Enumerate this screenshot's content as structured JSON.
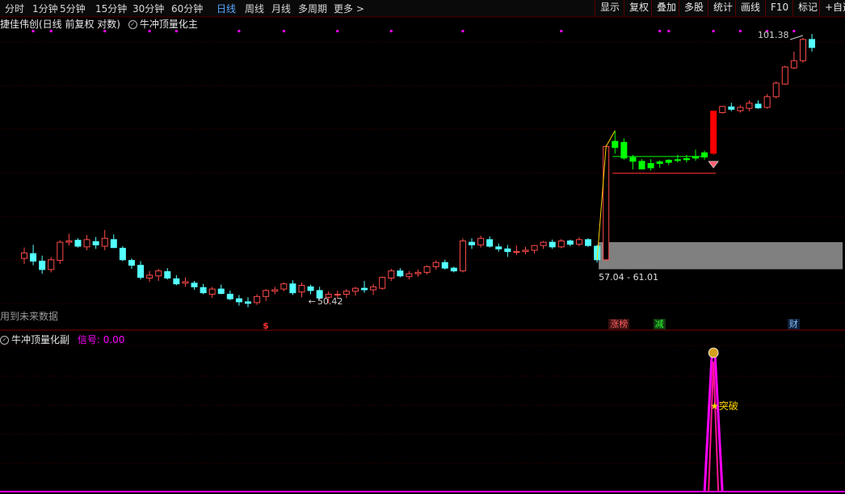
{
  "toolbar": {
    "periods": [
      {
        "label": "分时",
        "active": false
      },
      {
        "label": "1分钟",
        "active": false
      },
      {
        "label": "5分钟",
        "active": false
      },
      {
        "label": "15分钟",
        "active": false
      },
      {
        "label": "30分钟",
        "active": false
      },
      {
        "label": "60分钟",
        "active": false
      },
      {
        "label": "日线",
        "active": true
      },
      {
        "label": "周线",
        "active": false
      },
      {
        "label": "月线",
        "active": false
      },
      {
        "label": "多周期",
        "active": false
      },
      {
        "label": "更多 >",
        "active": false
      }
    ],
    "buttons": [
      "显示",
      "复权",
      "叠加",
      "多股",
      "统计",
      "画线",
      "F10",
      "标记",
      "+自选"
    ]
  },
  "main_panel": {
    "stock_title": "捷佳伟创(日线 前复权 对数)",
    "indicator_name": "牛冲顶量化主",
    "future_data_note": "用到未来数据",
    "high_label": "101.38",
    "low_label": "50.42",
    "zone_label": "57.04 - 61.01",
    "markers": {
      "dollar": "$",
      "zhangbang": "涨榜",
      "jian": "减",
      "cai": "财"
    }
  },
  "sub_panel": {
    "indicator_name": "牛冲顶量化副",
    "signal_label": "信号:",
    "signal_value": "0.00",
    "breakout_label": "突破"
  },
  "colors": {
    "up": "#ff4a4a",
    "down": "#54ffff",
    "signal_green": "#00ff00",
    "magenta": "#ff00ff",
    "pink_line": "#ff1493",
    "zone_gray": "#808080",
    "gold": "#ffd700"
  },
  "chart_data": {
    "type": "candlestick",
    "scale": "log",
    "candles": [
      [
        58.6,
        60.2,
        57.8,
        59.4
      ],
      [
        59.3,
        60.6,
        57.6,
        58.2
      ],
      [
        58.2,
        59.0,
        56.4,
        57.0
      ],
      [
        57.0,
        58.8,
        56.6,
        58.4
      ],
      [
        58.3,
        61.3,
        57.8,
        61.0
      ],
      [
        61.0,
        62.3,
        60.5,
        61.2
      ],
      [
        61.3,
        61.6,
        60.2,
        60.4
      ],
      [
        60.3,
        62.1,
        59.8,
        61.4
      ],
      [
        61.1,
        61.8,
        60.0,
        60.6
      ],
      [
        60.4,
        62.9,
        59.8,
        61.6
      ],
      [
        61.4,
        62.2,
        60.1,
        60.2
      ],
      [
        60.1,
        60.4,
        58.2,
        58.4
      ],
      [
        58.3,
        58.6,
        57.1,
        57.6
      ],
      [
        57.6,
        58.2,
        55.6,
        55.9
      ],
      [
        55.8,
        56.8,
        55.3,
        56.2
      ],
      [
        56.1,
        57.1,
        55.4,
        56.8
      ],
      [
        56.7,
        57.2,
        55.6,
        55.8
      ],
      [
        55.7,
        56.2,
        54.8,
        55.0
      ],
      [
        55.1,
        55.9,
        54.6,
        55.3
      ],
      [
        55.1,
        55.4,
        54.2,
        54.6
      ],
      [
        54.5,
        55.0,
        53.6,
        53.8
      ],
      [
        53.6,
        54.6,
        53.1,
        54.3
      ],
      [
        54.3,
        54.9,
        53.6,
        53.7
      ],
      [
        53.6,
        54.1,
        52.8,
        53.0
      ],
      [
        53.0,
        53.5,
        52.1,
        52.6
      ],
      [
        52.6,
        53.2,
        51.9,
        52.4
      ],
      [
        52.5,
        53.6,
        52.2,
        53.3
      ],
      [
        53.3,
        54.3,
        52.7,
        54.1
      ],
      [
        54.0,
        54.6,
        53.6,
        54.2
      ],
      [
        54.3,
        55.2,
        54.0,
        55.0
      ],
      [
        55.0,
        55.5,
        53.5,
        53.8
      ],
      [
        53.9,
        55.2,
        53.2,
        54.8
      ],
      [
        54.6,
        54.9,
        53.6,
        54.1
      ],
      [
        54.1,
        54.6,
        52.9,
        53.1
      ],
      [
        53.2,
        54.0,
        52.4,
        53.6
      ],
      [
        53.5,
        54.1,
        53.0,
        53.6
      ],
      [
        53.6,
        54.3,
        53.1,
        54.0
      ],
      [
        54.0,
        54.6,
        53.4,
        54.4
      ],
      [
        54.4,
        55.4,
        53.8,
        54.2
      ],
      [
        54.2,
        55.0,
        53.5,
        54.6
      ],
      [
        54.4,
        56.0,
        54.2,
        55.9
      ],
      [
        55.8,
        57.1,
        55.4,
        56.8
      ],
      [
        56.8,
        57.2,
        55.9,
        56.1
      ],
      [
        56.0,
        56.8,
        55.6,
        56.4
      ],
      [
        56.4,
        57.0,
        56.0,
        56.6
      ],
      [
        56.6,
        57.6,
        56.3,
        57.4
      ],
      [
        57.4,
        58.3,
        57.0,
        58.0
      ],
      [
        58.0,
        58.4,
        57.0,
        57.2
      ],
      [
        57.2,
        57.4,
        56.6,
        56.8
      ],
      [
        56.8,
        61.6,
        56.6,
        61.2
      ],
      [
        61.0,
        61.6,
        60.0,
        60.6
      ],
      [
        60.6,
        62.0,
        60.2,
        61.6
      ],
      [
        61.4,
        61.9,
        60.2,
        60.4
      ],
      [
        60.3,
        60.8,
        59.6,
        60.0
      ],
      [
        60.0,
        60.6,
        58.8,
        59.6
      ],
      [
        59.6,
        60.5,
        59.1,
        59.6
      ],
      [
        59.6,
        60.3,
        59.2,
        59.8
      ],
      [
        59.8,
        60.6,
        59.3,
        60.5
      ],
      [
        60.5,
        61.2,
        60.0,
        61.0
      ],
      [
        61.0,
        61.4,
        60.0,
        60.3
      ],
      [
        60.3,
        61.5,
        60.1,
        61.2
      ],
      [
        61.2,
        61.4,
        60.4,
        60.7
      ],
      [
        60.7,
        61.8,
        60.4,
        61.4
      ],
      [
        61.4,
        61.6,
        60.3,
        60.5
      ],
      [
        60.4,
        60.6,
        58.0,
        58.4
      ],
      [
        58.4,
        77.6,
        58.2,
        77.4
      ],
      [
        77.2,
        80.5,
        76.0,
        78.4
      ],
      [
        78.2,
        79.0,
        74.9,
        75.2
      ],
      [
        75.3,
        75.8,
        73.1,
        74.6
      ],
      [
        74.6,
        75.0,
        73.1,
        73.2
      ],
      [
        73.4,
        75.0,
        72.9,
        74.2
      ],
      [
        74.2,
        74.8,
        73.4,
        74.5
      ],
      [
        74.4,
        75.0,
        73.9,
        74.8
      ],
      [
        74.8,
        75.8,
        74.4,
        74.9
      ],
      [
        74.9,
        75.8,
        74.4,
        75.1
      ],
      [
        75.2,
        76.8,
        74.7,
        75.5
      ],
      [
        75.4,
        76.6,
        74.9,
        76.2
      ],
      [
        76.1,
        84.6,
        75.8,
        84.5
      ],
      [
        84.2,
        85.6,
        84.0,
        85.5
      ],
      [
        85.4,
        86.3,
        84.5,
        84.9
      ],
      [
        84.6,
        85.8,
        84.2,
        85.3
      ],
      [
        85.1,
        86.8,
        84.5,
        86.2
      ],
      [
        86.0,
        86.8,
        85.0,
        85.2
      ],
      [
        85.3,
        88.2,
        85.0,
        87.6
      ],
      [
        87.6,
        91.0,
        87.2,
        90.6
      ],
      [
        90.4,
        94.6,
        90.2,
        94.3
      ],
      [
        94.1,
        98.0,
        93.8,
        95.8
      ],
      [
        95.8,
        101.4,
        95.3,
        101.0
      ],
      [
        101.0,
        102.4,
        98.0,
        99.0
      ]
    ],
    "dollar_signal_index": 27,
    "low_label_index": 33,
    "yellow_breakout_line": {
      "from_index": 64,
      "to_index": 66
    },
    "green_signal_indices": [
      66,
      67,
      68,
      69,
      70,
      71,
      72,
      73,
      74,
      75,
      76
    ],
    "signal_box": {
      "from_index": 66,
      "to_index": 76,
      "top": 75.5,
      "bottom": 73.0
    },
    "breakout_index": 77,
    "gray_zone": {
      "from_index": 64,
      "low": 57.04,
      "high": 61.01
    },
    "badges": [
      {
        "key": "zhangbang",
        "index": 66
      },
      {
        "key": "jian",
        "index": 71
      },
      {
        "key": "cai",
        "index": 86
      }
    ],
    "top_dots_indices": [
      1,
      3,
      9,
      14,
      17,
      24,
      29,
      35,
      41,
      49,
      60,
      71,
      72,
      77,
      80,
      83,
      86
    ],
    "sub_signal": {
      "peak_index": 77,
      "value_peak": 1,
      "value_base": 0
    }
  }
}
